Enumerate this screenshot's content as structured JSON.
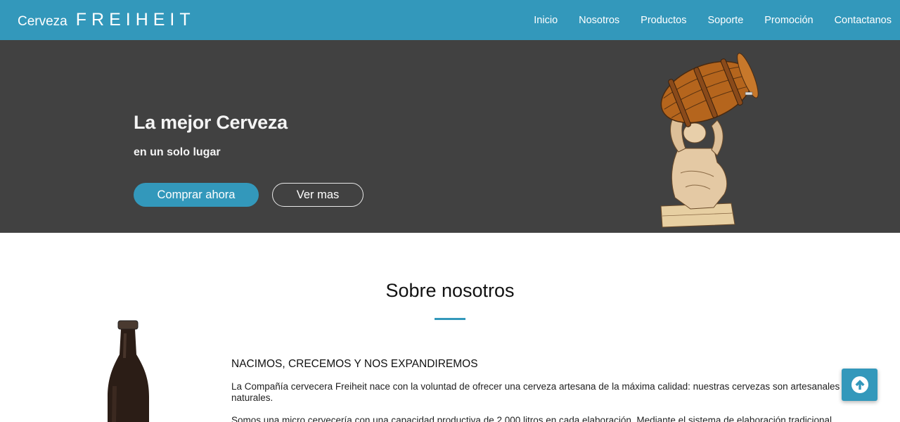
{
  "brand": {
    "prefix": "Cerveza",
    "name": "FREIHEIT"
  },
  "nav": {
    "items": [
      "Inicio",
      "Nosotros",
      "Productos",
      "Soporte",
      "Promoción",
      "Contactanos"
    ]
  },
  "hero": {
    "title": "La mejor Cerveza",
    "subtitle": "en un solo lugar",
    "primary_button": "Comprar ahora",
    "secondary_button": "Ver mas"
  },
  "about": {
    "title": "Sobre nosotros",
    "heading": "NACIMOS, CRECEMOS Y NOS EXPANDIREMOS",
    "p1": "La Compañía cervecera Freiheit nace con la voluntad de ofrecer una cerveza artesana de la máxima calidad: nuestras cervezas son artesanales y naturales.",
    "p2": "Somos una micro cervecería con una capacidad productiva de 2.000 litros en cada elaboración. Mediante el sistema de elaboración tradicional"
  },
  "colors": {
    "accent": "#3398bb",
    "hero_bg": "#414141"
  },
  "icons": {
    "scroll_top": "arrow-up-circle-icon"
  }
}
